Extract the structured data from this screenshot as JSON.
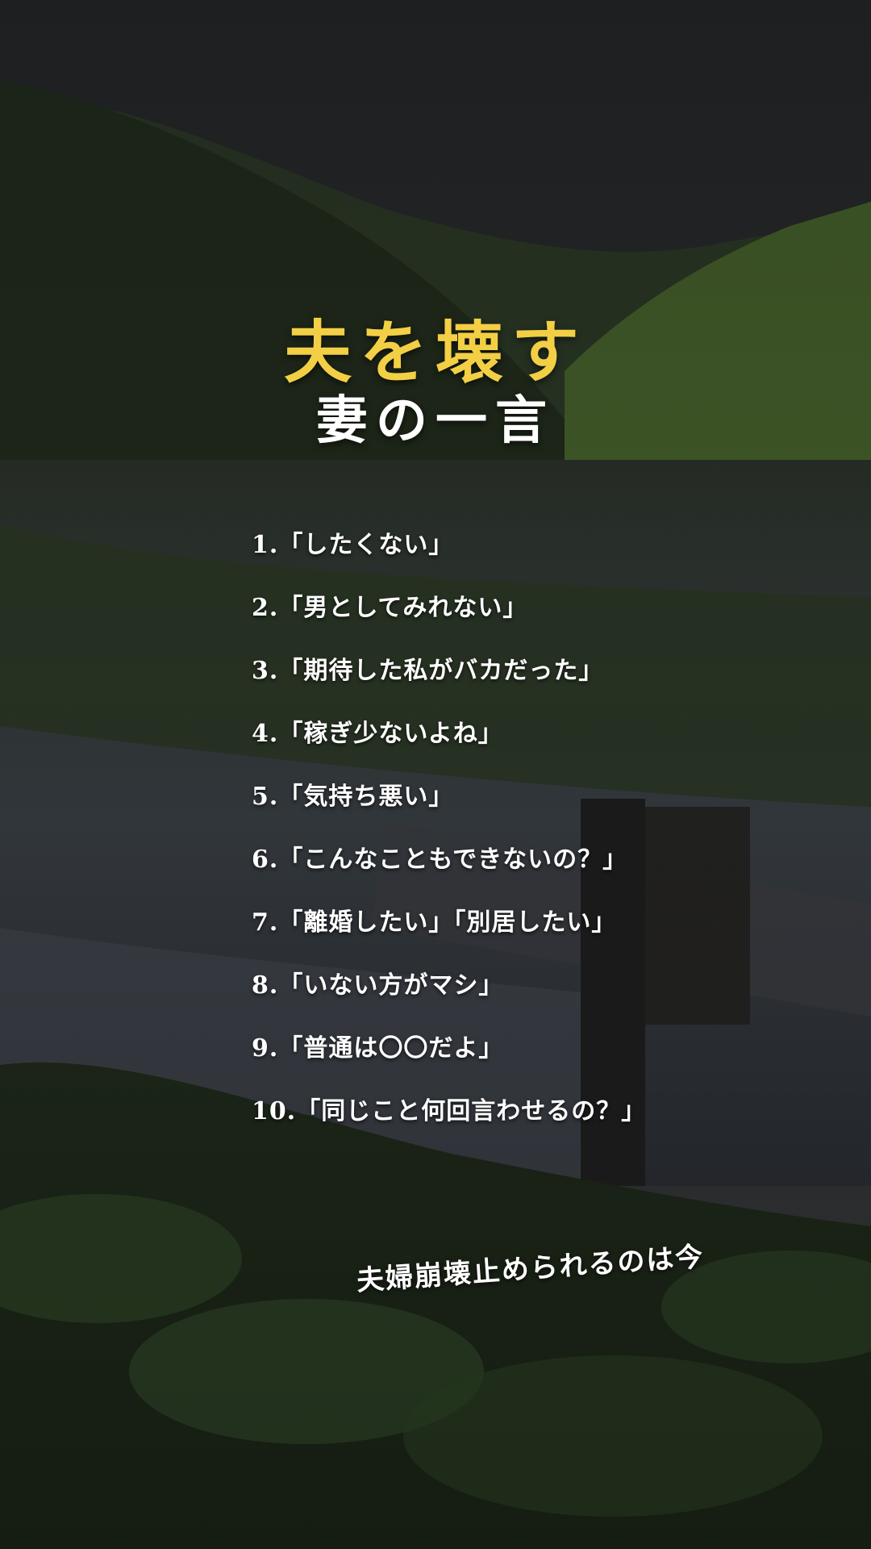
{
  "title": "夫を壊す",
  "subtitle": "妻の一言",
  "items": [
    "1.「したくない」",
    "2.「男としてみれない」",
    "3.「期待した私がバカだった」",
    "4.「稼ぎ少ないよね」",
    "5.「気持ち悪い」",
    "6.「こんなこともできないの？」",
    "7.「離婚したい」「別居したい」",
    "8.「いない方がマシ」",
    "9.「普通は〇〇だよ」",
    "10.「同じこと何回言わせるの？」"
  ],
  "footer": "夫婦崩壊止められるのは今",
  "colors": {
    "title": "#f3cf45",
    "text": "#ffffff",
    "sky": "#2a2c2e",
    "foliage": "#2f4a22"
  }
}
